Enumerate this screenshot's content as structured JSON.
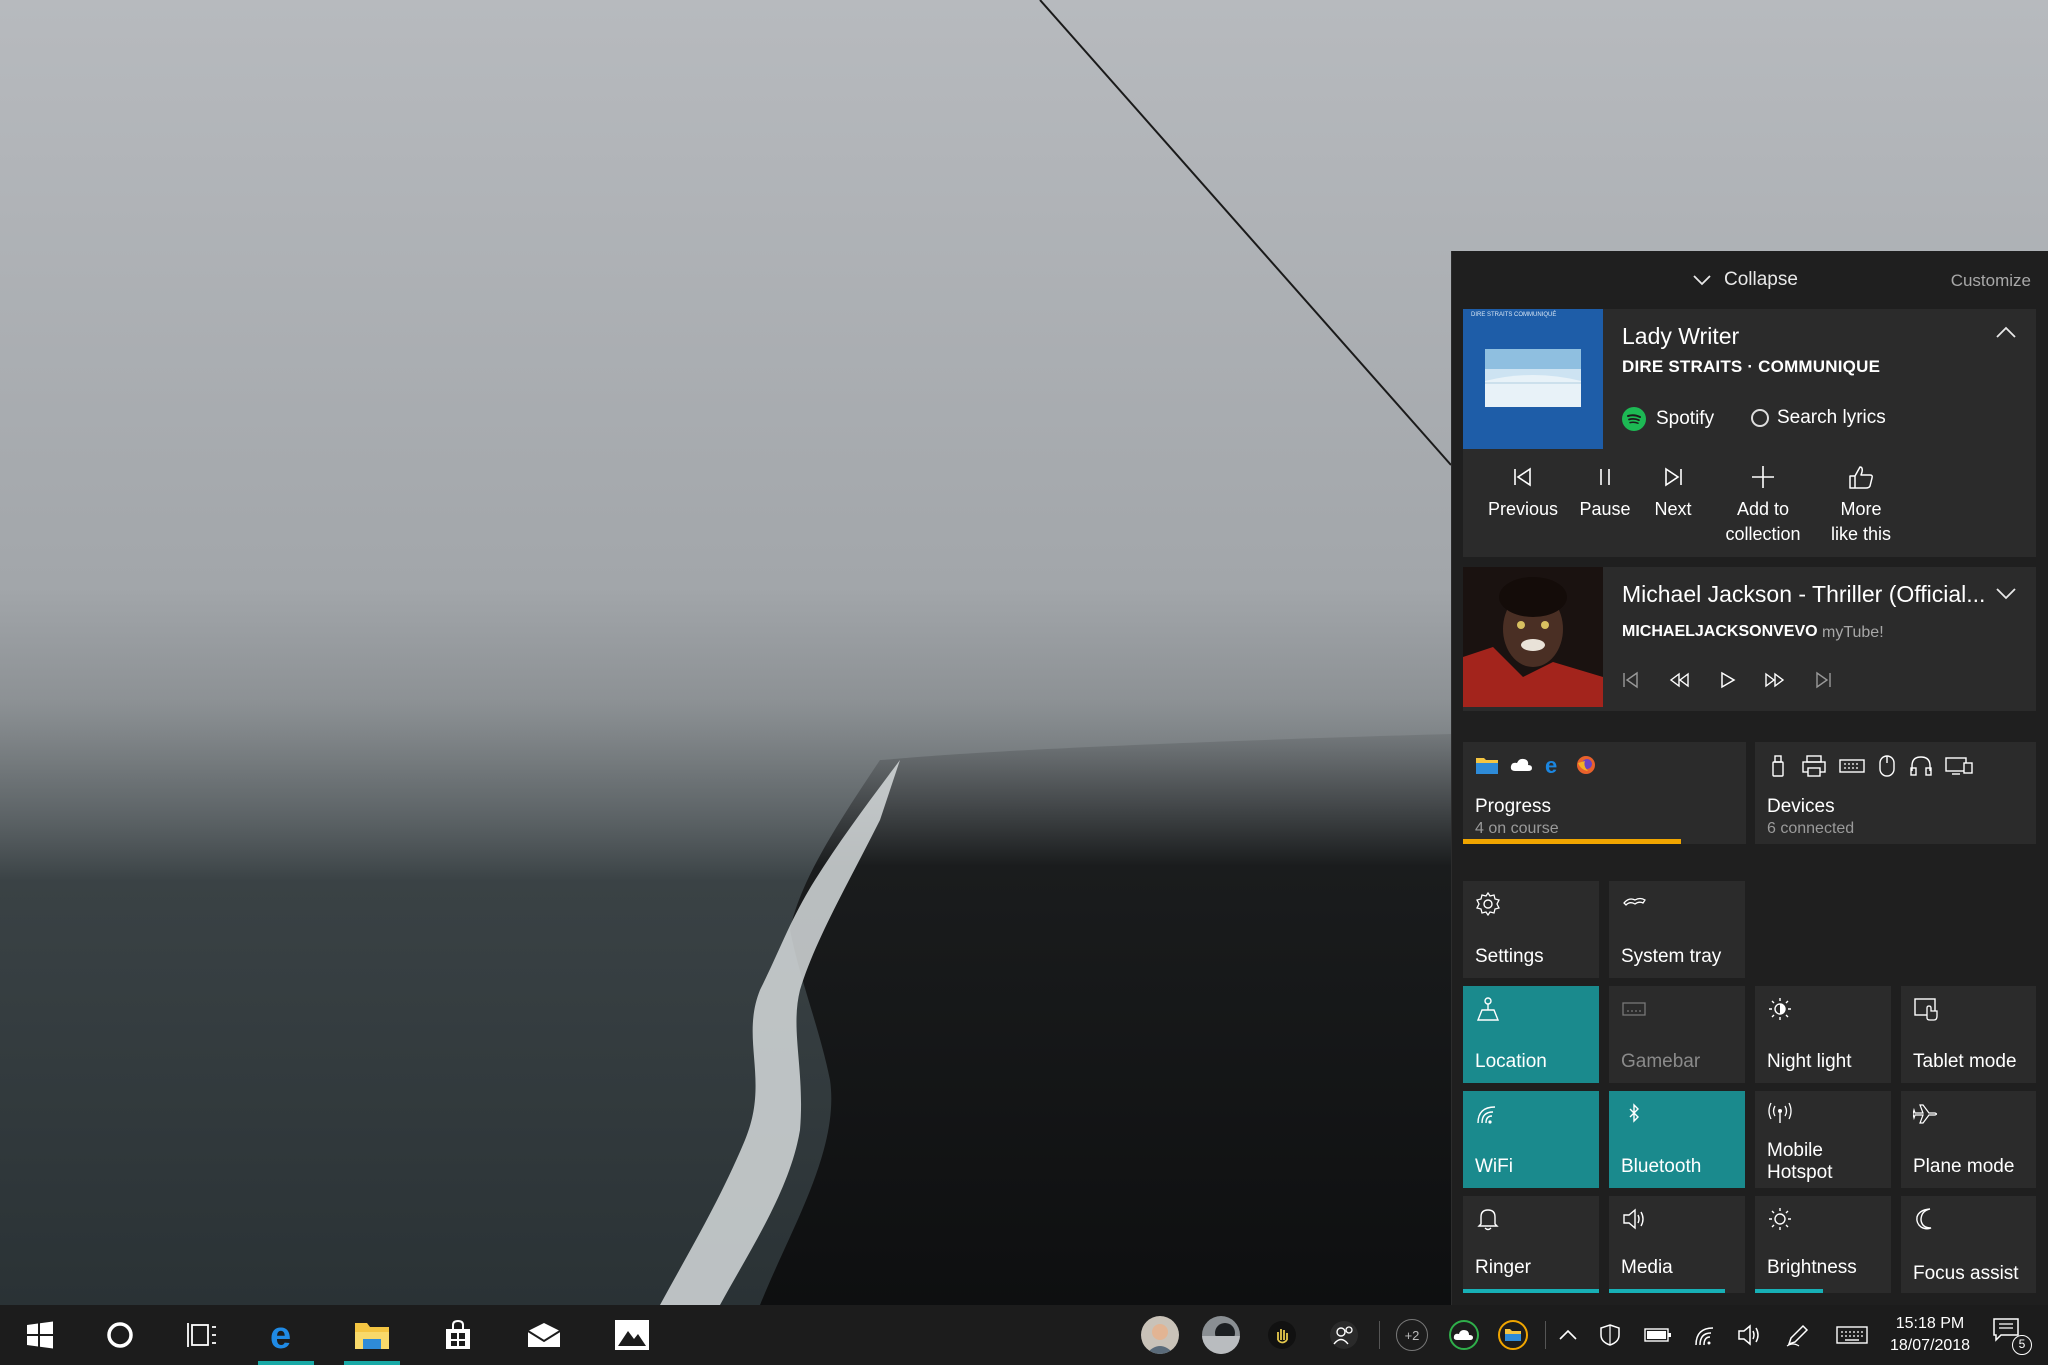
{
  "action_center": {
    "collapse_label": "Collapse",
    "customize_label": "Customize",
    "now_playing": {
      "title": "Lady Writer",
      "subtitle": "DIRE STRAITS · COMMUNIQUE",
      "app": "Spotify",
      "lyrics_label": "Search lyrics",
      "album_header": "DIRE STRAITS   COMMUNIQUÉ",
      "controls": {
        "previous": "Previous",
        "pause": "Pause",
        "next": "Next",
        "add_line1": "Add to",
        "add_line2": "collection",
        "more_line1": "More",
        "more_line2": "like this"
      }
    },
    "secondary_media": {
      "title": "Michael Jackson - Thriller (Official...",
      "channel": "MICHAELJACKSONVEVO",
      "app": "myTube!"
    },
    "progress_tile": {
      "title": "Progress",
      "subtitle": "4 on course",
      "progress_fraction": 0.77
    },
    "devices_tile": {
      "title": "Devices",
      "subtitle": "6 connected"
    },
    "tiles": {
      "settings": "Settings",
      "system_tray": "System tray",
      "location": "Location",
      "gamebar": "Gamebar",
      "night_light": "Night light",
      "tablet_mode": "Tablet mode",
      "wifi": "WiFi",
      "bluetooth": "Bluetooth",
      "mobile_hotspot_line1": "Mobile",
      "mobile_hotspot_line2": "Hotspot",
      "plane_mode": "Plane mode",
      "ringer": "Ringer",
      "media": "Media",
      "brightness": "Brightness",
      "focus_assist": "Focus assist"
    },
    "levels": {
      "ringer": 1.0,
      "media": 0.85,
      "brightness": 0.5
    }
  },
  "taskbar": {
    "overflow_count": "+2",
    "clock_time": "15:18 PM",
    "clock_date": "18/07/2018",
    "notification_count": "5"
  },
  "colors": {
    "accent": "#1a8a8d",
    "accent_bar": "#17b0b6",
    "progress_orange": "#f0a500",
    "panel": "#1f1f1f",
    "tile": "#2b2b2b"
  },
  "icons": [
    "chevron-down-icon",
    "chevron-up-icon",
    "spotify-icon",
    "previous-icon",
    "pause-icon",
    "next-icon",
    "add-icon",
    "thumbs-up-icon",
    "rewind-icon",
    "play-icon",
    "fast-forward-icon",
    "folder-icon",
    "cloud-icon",
    "edge-icon",
    "firefox-icon",
    "usb-icon",
    "printer-icon",
    "keyboard-icon",
    "mouse-icon",
    "headphones-icon",
    "display-icon",
    "gear-icon",
    "system-tray-icon",
    "location-icon",
    "gamebar-icon",
    "night-light-icon",
    "tablet-mode-icon",
    "wifi-icon",
    "bluetooth-icon",
    "hotspot-icon",
    "plane-icon",
    "bell-icon",
    "speaker-icon",
    "brightness-icon",
    "moon-icon",
    "windows-start-icon",
    "cortana-icon",
    "task-view-icon",
    "store-icon",
    "mail-icon",
    "photos-icon",
    "people-icon",
    "onedrive-icon",
    "chevron-up-tray-icon",
    "defender-icon",
    "battery-icon",
    "pen-icon",
    "touch-keyboard-icon",
    "notification-icon"
  ]
}
